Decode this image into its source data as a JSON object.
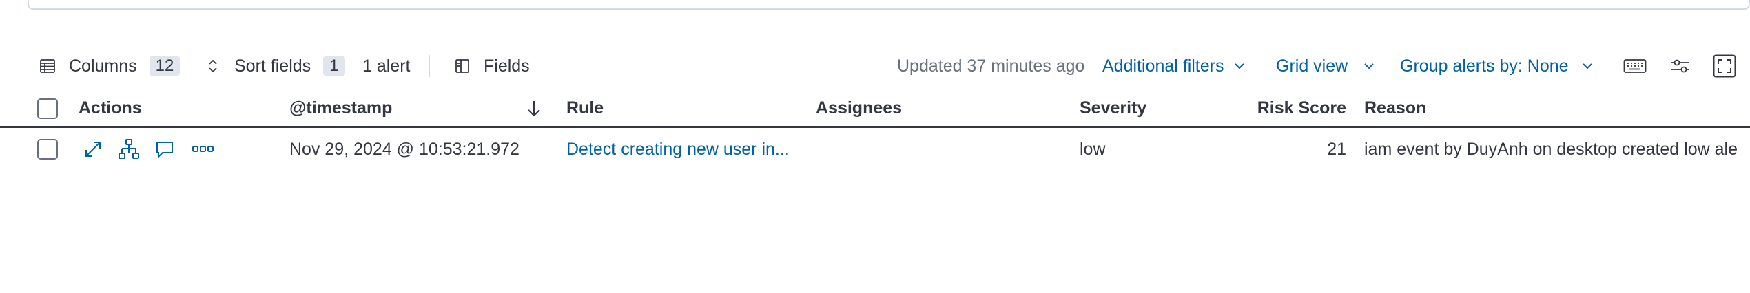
{
  "toolbar": {
    "columns_label": "Columns",
    "columns_count": "12",
    "sort_label": "Sort fields",
    "sort_count": "1",
    "alert_count": "1 alert",
    "fields_label": "Fields",
    "updated_text": "Updated 37 minutes ago",
    "additional_filters": "Additional filters",
    "grid_view": "Grid view",
    "group_alerts": "Group alerts by: None"
  },
  "table": {
    "headers": {
      "actions": "Actions",
      "timestamp": "@timestamp",
      "rule": "Rule",
      "assignees": "Assignees",
      "severity": "Severity",
      "risk_score": "Risk Score",
      "reason": "Reason"
    },
    "rows": [
      {
        "timestamp": "Nov 29, 2024 @ 10:53:21.972",
        "rule": "Detect creating new user in...",
        "assignees": "",
        "severity": "low",
        "risk_score": "21",
        "reason": "iam event by DuyAnh on desktop created low ale"
      }
    ]
  },
  "colors": {
    "link": "#0061a6",
    "text": "#343741",
    "muted": "#69707d",
    "border": "#d3dae6"
  }
}
